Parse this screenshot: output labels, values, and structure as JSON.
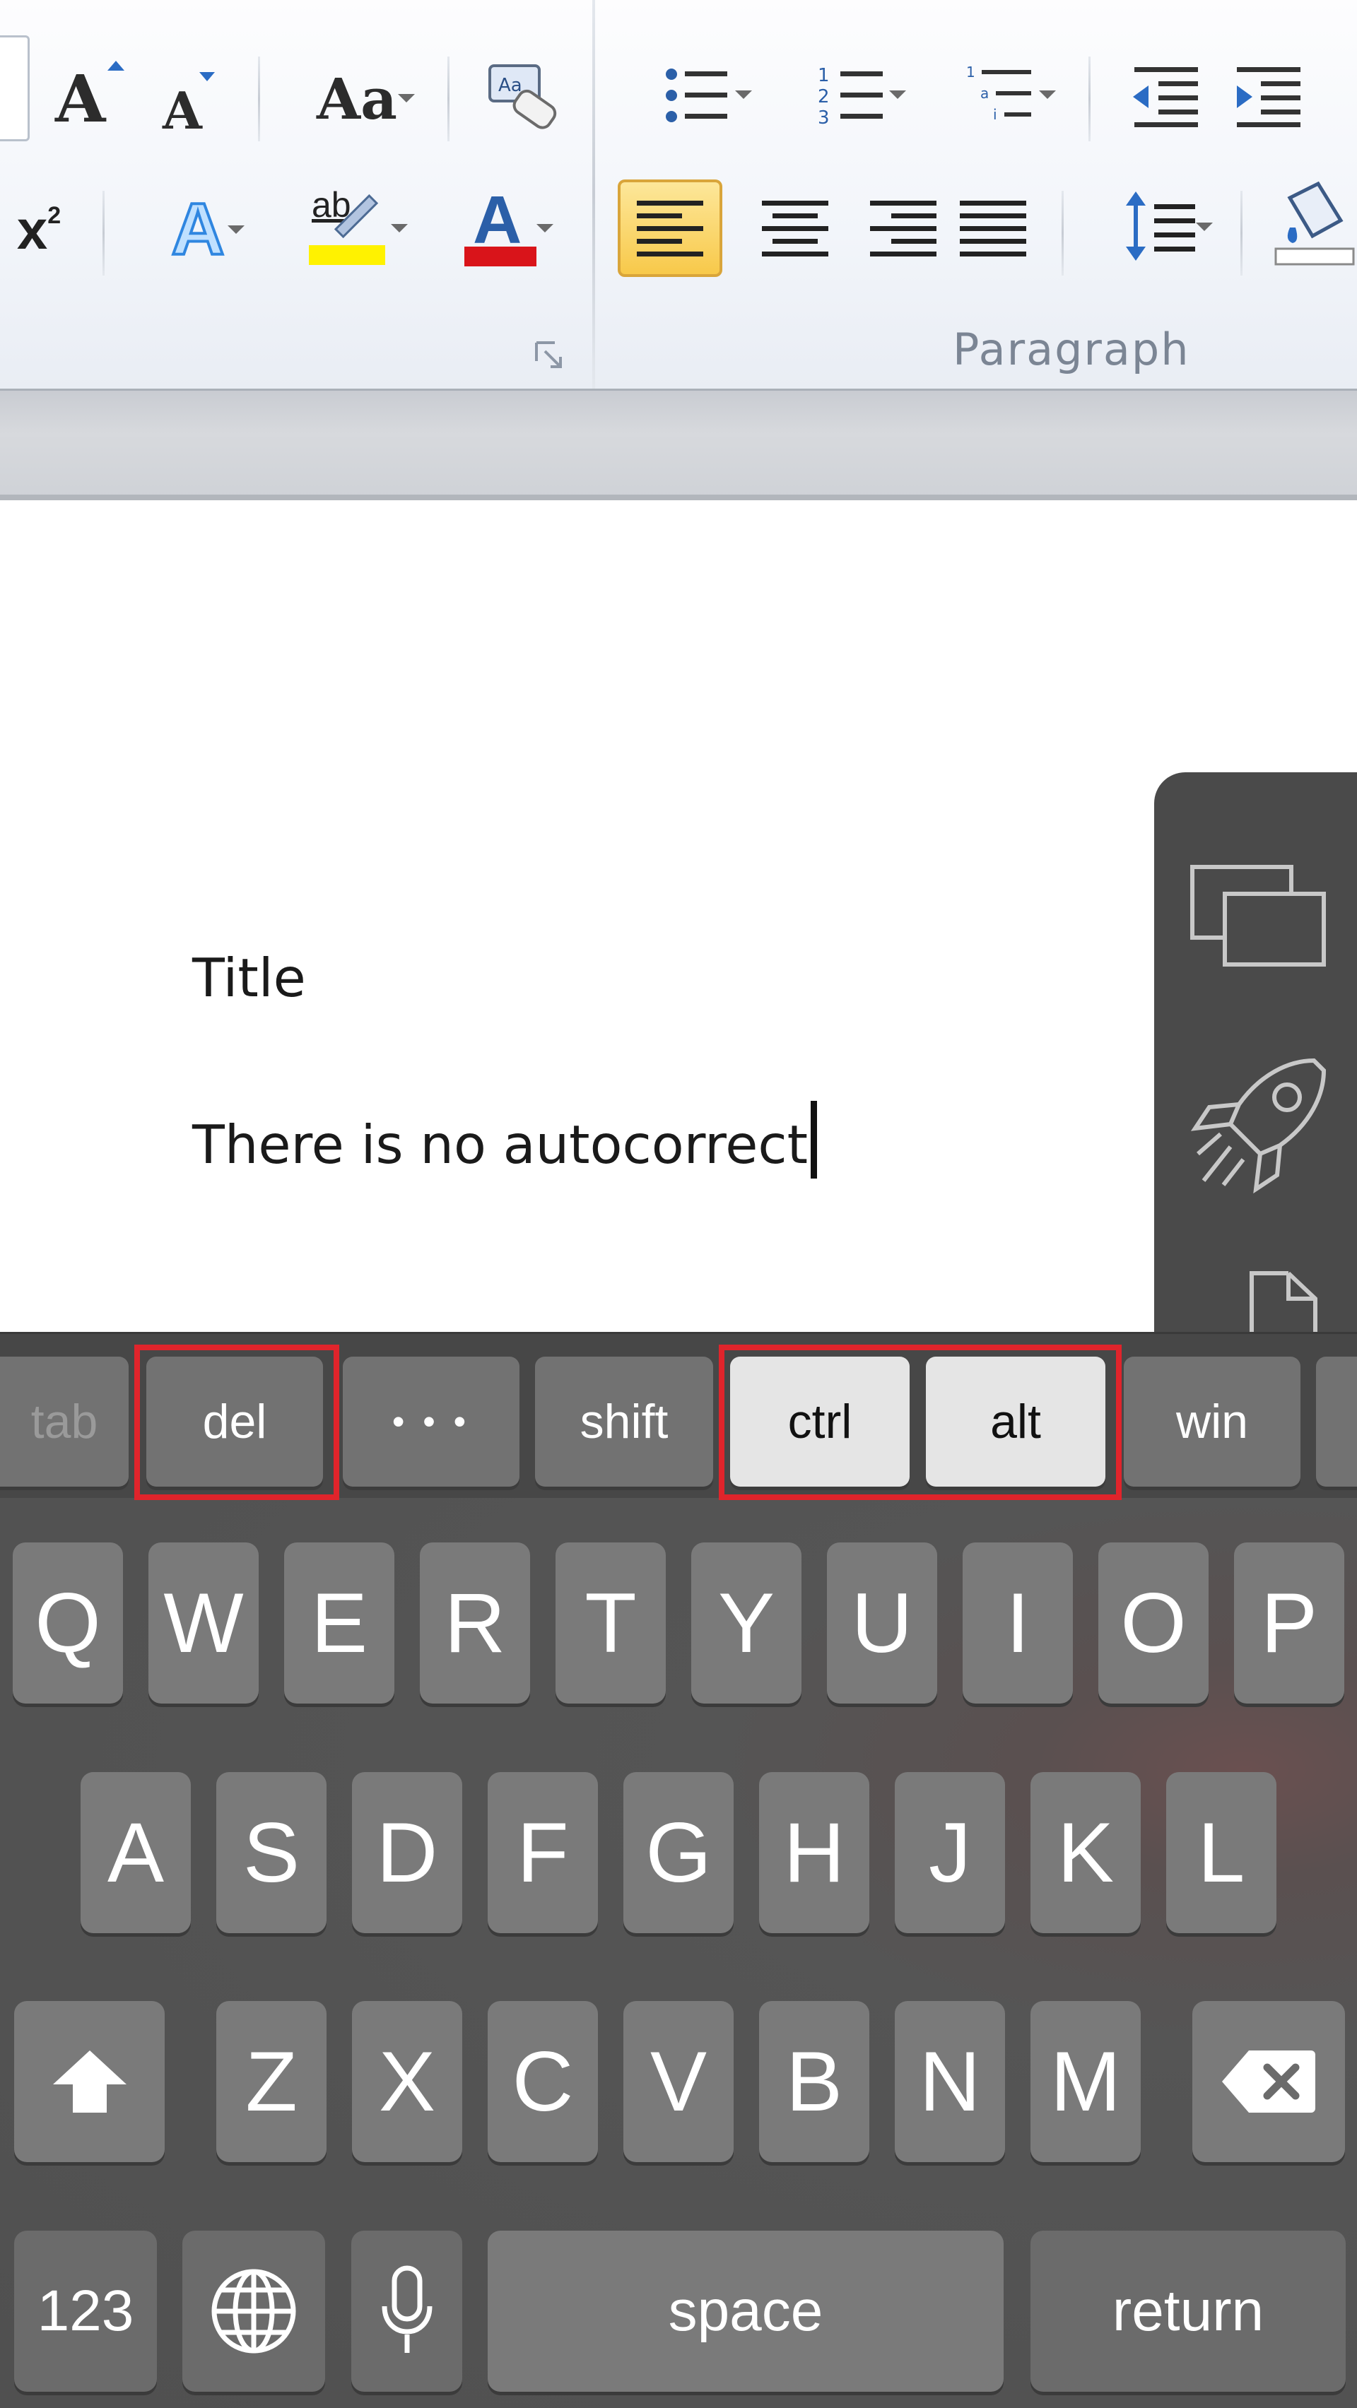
{
  "ribbon": {
    "paragraph_group_label": "Paragraph",
    "font_buttons": {
      "grow_font_icon": "grow-font-icon",
      "shrink_font_icon": "shrink-font-icon",
      "change_case_label": "Aa",
      "clear_formatting_icon": "clear-formatting-icon",
      "superscript_label": "x",
      "superscript_exp": "2",
      "text_effects_label": "A",
      "highlight_label": "ab",
      "font_color_label": "A"
    },
    "colors": {
      "highlight": "#fff200",
      "font_color": "#d9141a",
      "align_active_bg": "#fbd85d"
    }
  },
  "document": {
    "line_1": "Title",
    "line_2": "There is no autocorrect"
  },
  "keyboard": {
    "special_keys": {
      "tab": "tab",
      "del": "del",
      "more": "• • •",
      "shift": "shift",
      "ctrl": "ctrl",
      "alt": "alt",
      "win": "win"
    },
    "row1": [
      "Q",
      "W",
      "E",
      "R",
      "T",
      "Y",
      "U",
      "I",
      "O",
      "P"
    ],
    "row2": [
      "A",
      "S",
      "D",
      "F",
      "G",
      "H",
      "J",
      "K",
      "L"
    ],
    "row3": [
      "Z",
      "X",
      "C",
      "V",
      "B",
      "N",
      "M"
    ],
    "numbers_label": "123",
    "space_label": "space",
    "return_label": "return",
    "highlight_color": "#e0242b"
  }
}
